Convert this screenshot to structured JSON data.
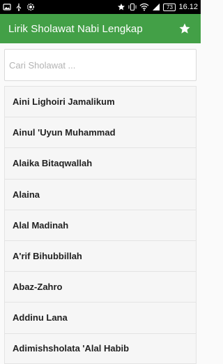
{
  "status_bar": {
    "time": "16.12",
    "battery": "73"
  },
  "app_bar": {
    "title": "Lirik Sholawat Nabi Lengkap"
  },
  "search": {
    "placeholder": "Cari Sholawat ..."
  },
  "list": [
    "Aini Lighoiri Jamalikum",
    "Ainul 'Uyun Muhammad",
    "Alaika Bitaqwallah",
    "Alaina",
    "Alal Madinah",
    "A'rif Bihubbillah",
    "Abaz-Zahro",
    "Addinu Lana",
    "Adimishsholata 'Alal Habib"
  ],
  "colors": {
    "app_bar": "#43a047",
    "status_bar": "#000000"
  }
}
